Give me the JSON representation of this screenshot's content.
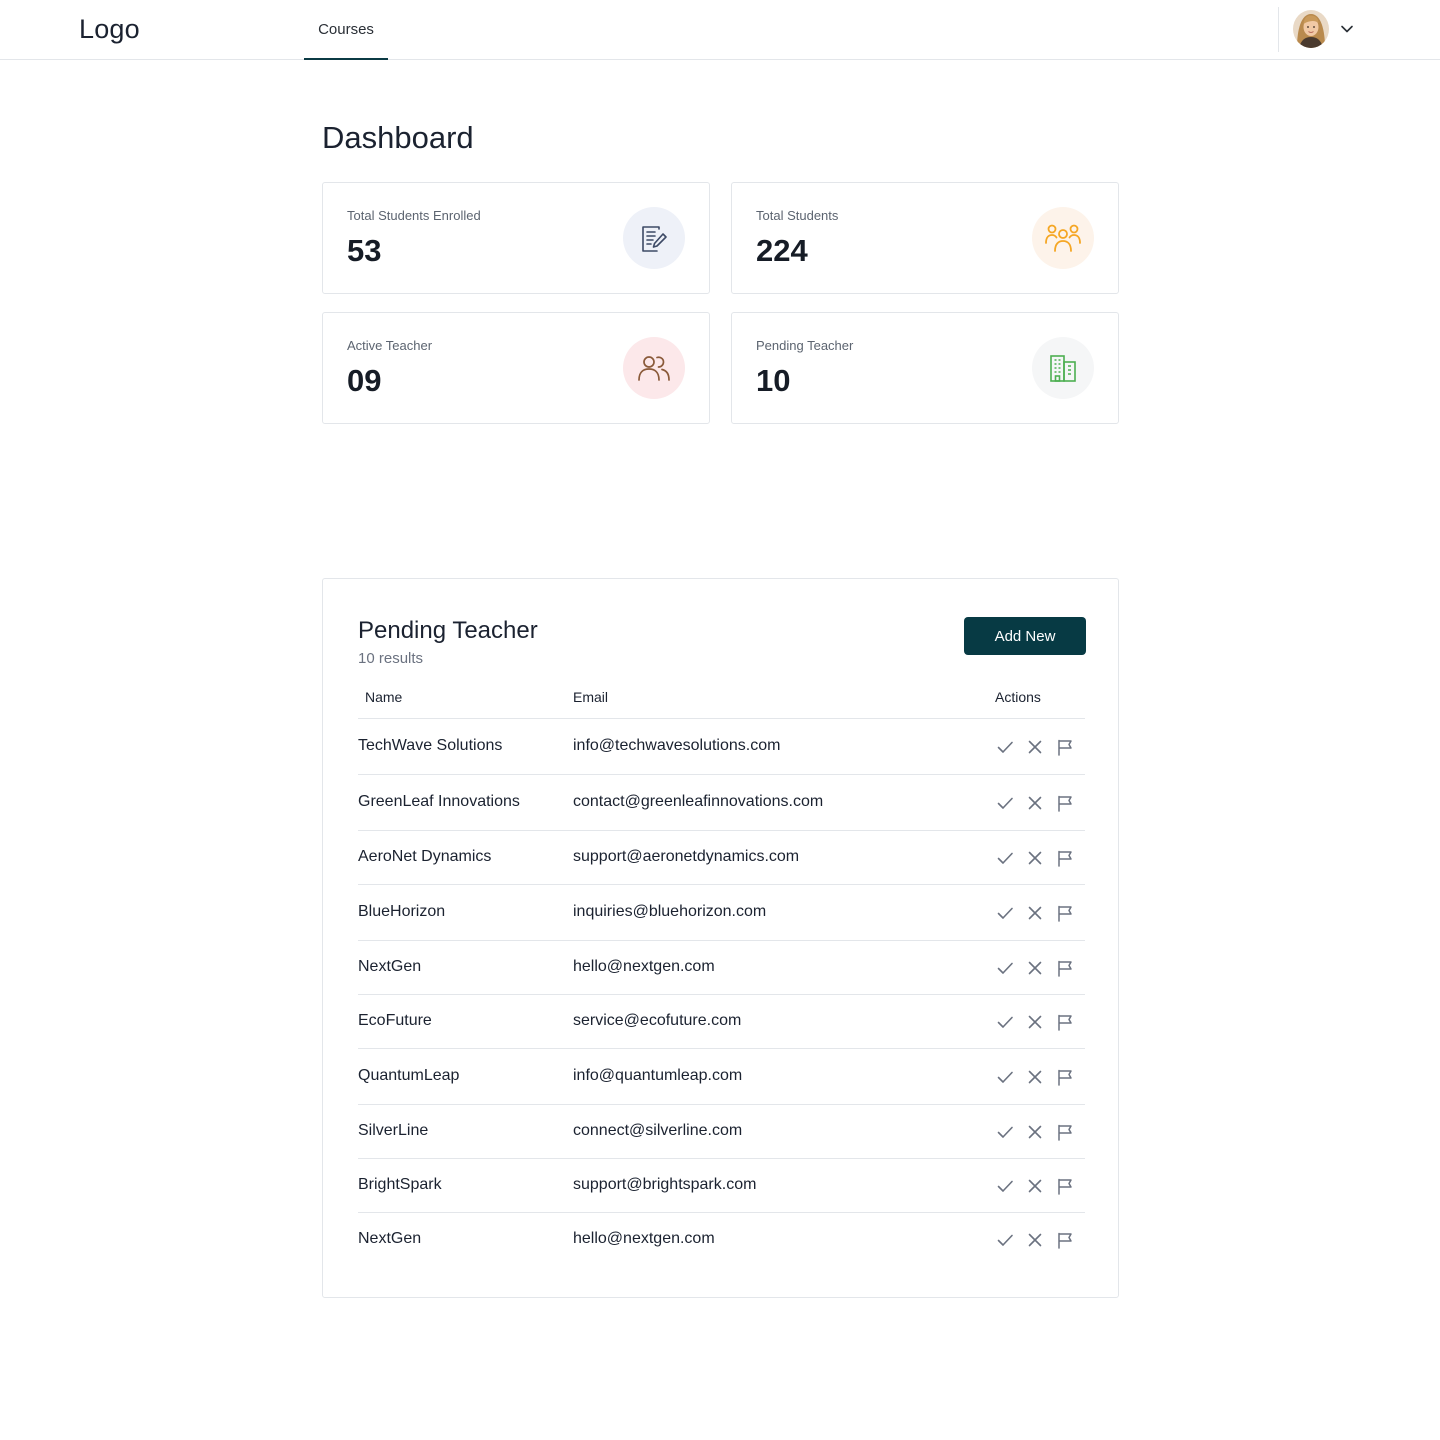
{
  "header": {
    "logo": "Logo",
    "nav": [
      {
        "label": "Courses",
        "active": true
      }
    ],
    "user_menu": {
      "avatar": "avatar",
      "icon": "chevron-down-icon"
    }
  },
  "page": {
    "title": "Dashboard"
  },
  "stats": [
    {
      "label": "Total Students Enrolled",
      "value": "53",
      "icon": "document-edit-icon",
      "icon_color": "#3d4a66",
      "icon_bg": "#eef1f8"
    },
    {
      "label": "Total Students",
      "value": "224",
      "icon": "group-icon",
      "icon_color": "#f5a623",
      "icon_bg": "#fdf3ea"
    },
    {
      "label": "Active Teacher",
      "value": "09",
      "icon": "users-icon",
      "icon_color": "#8a5a3a",
      "icon_bg": "#fce8ea"
    },
    {
      "label": "Pending Teacher",
      "value": "10",
      "icon": "building-icon",
      "icon_color": "#4caf50",
      "icon_bg": "#f5f6f7"
    }
  ],
  "pending": {
    "title": "Pending Teacher",
    "subtitle": "10 results",
    "add_label": "Add New",
    "columns": {
      "name": "Name",
      "email": "Email",
      "actions": "Actions"
    },
    "rows": [
      {
        "name": "TechWave Solutions",
        "email": "info@techwavesolutions.com"
      },
      {
        "name": "GreenLeaf Innovations",
        "email": "contact@greenleafinnovations.com"
      },
      {
        "name": "AeroNet Dynamics",
        "email": "support@aeronetdynamics.com"
      },
      {
        "name": "BlueHorizon",
        "email": "inquiries@bluehorizon.com"
      },
      {
        "name": "NextGen",
        "email": "hello@nextgen.com"
      },
      {
        "name": "EcoFuture",
        "email": "service@ecofuture.com"
      },
      {
        "name": "QuantumLeap",
        "email": "info@quantumleap.com"
      },
      {
        "name": "SilverLine",
        "email": "connect@silverline.com"
      },
      {
        "name": "BrightSpark",
        "email": "support@brightspark.com"
      },
      {
        "name": "NextGen",
        "email": "hello@nextgen.com"
      }
    ],
    "actions": [
      "check-icon",
      "close-icon",
      "flag-icon"
    ]
  }
}
